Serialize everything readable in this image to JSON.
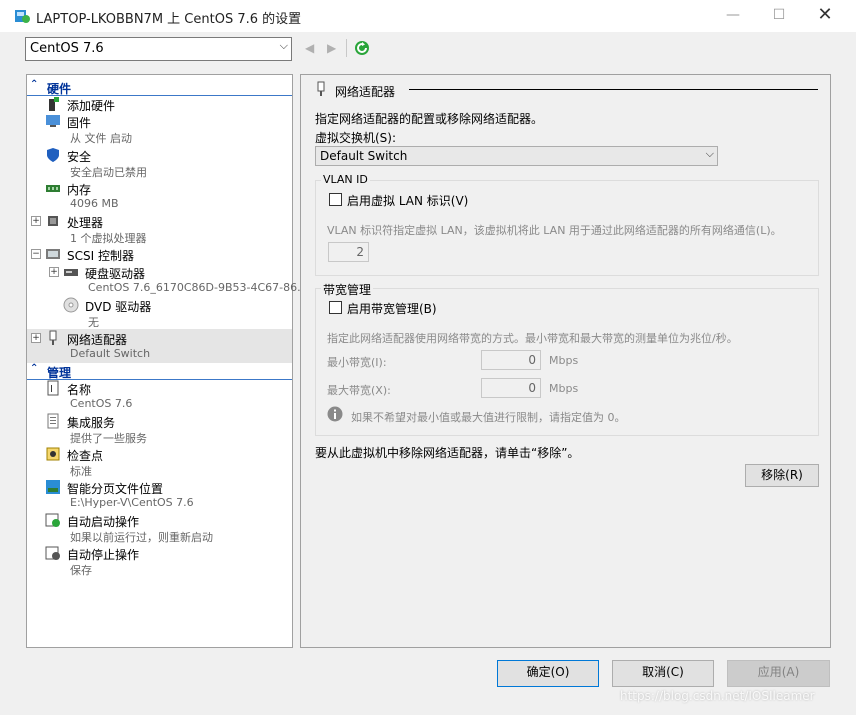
{
  "window": {
    "title": "LAPTOP-LKOBBN7M 上 CentOS 7.6 的设置"
  },
  "vm_selector": {
    "value": "CentOS 7.6"
  },
  "tree": {
    "hardware_header": "硬件",
    "management_header": "管理",
    "hardware": [
      {
        "label": "添加硬件",
        "sub": ""
      },
      {
        "label": "固件",
        "sub": "从 文件 启动"
      },
      {
        "label": "安全",
        "sub": "安全启动已禁用"
      },
      {
        "label": "内存",
        "sub": "4096 MB"
      },
      {
        "label": "处理器",
        "sub": "1 个虚拟处理器"
      },
      {
        "label": "SCSI 控制器",
        "sub": ""
      },
      {
        "label": "硬盘驱动器",
        "sub": "CentOS 7.6_6170C86D-9B53-4C67-86..."
      },
      {
        "label": "DVD 驱动器",
        "sub": "无"
      },
      {
        "label": "网络适配器",
        "sub": "Default Switch"
      }
    ],
    "management": [
      {
        "label": "名称",
        "sub": "CentOS 7.6"
      },
      {
        "label": "集成服务",
        "sub": "提供了一些服务"
      },
      {
        "label": "检查点",
        "sub": "标准"
      },
      {
        "label": "智能分页文件位置",
        "sub": "E:\\Hyper-V\\CentOS 7.6"
      },
      {
        "label": "自动启动操作",
        "sub": "如果以前运行过，则重新启动"
      },
      {
        "label": "自动停止操作",
        "sub": "保存"
      }
    ]
  },
  "right": {
    "section_title": "网络适配器",
    "description": "指定网络适配器的配置或移除网络适配器。",
    "switch_label": "虚拟交换机(S):",
    "switch_value": "Default Switch",
    "vlan": {
      "group_title": "VLAN ID",
      "checkbox_label": "启用虚拟 LAN 标识(V)",
      "checked": false,
      "help": "VLAN 标识符指定虚拟 LAN，该虚拟机将此 LAN 用于通过此网络适配器的所有网络通信(L)。",
      "value": "2"
    },
    "bandwidth": {
      "group_title": "带宽管理",
      "checkbox_label": "启用带宽管理(B)",
      "checked": false,
      "help": "指定此网络适配器使用网络带宽的方式。最小带宽和最大带宽的测量单位为兆位/秒。",
      "min_label": "最小带宽(I):",
      "min_value": "0",
      "max_label": "最大带宽(X):",
      "max_value": "0",
      "unit": "Mbps",
      "info": "如果不希望对最小值或最大值进行限制，请指定值为 0。"
    },
    "remove_text": "要从此虚拟机中移除网络适配器，请单击“移除”。",
    "remove_button": "移除(R)"
  },
  "footer": {
    "ok": "确定(O)",
    "cancel": "取消(C)",
    "apply": "应用(A)"
  },
  "watermark": "https://blog.csdn.net/IOSIleamer",
  "colors": {
    "accent": "#3c78c8",
    "header_text": "#003399",
    "selection": "#e5e5e5"
  }
}
